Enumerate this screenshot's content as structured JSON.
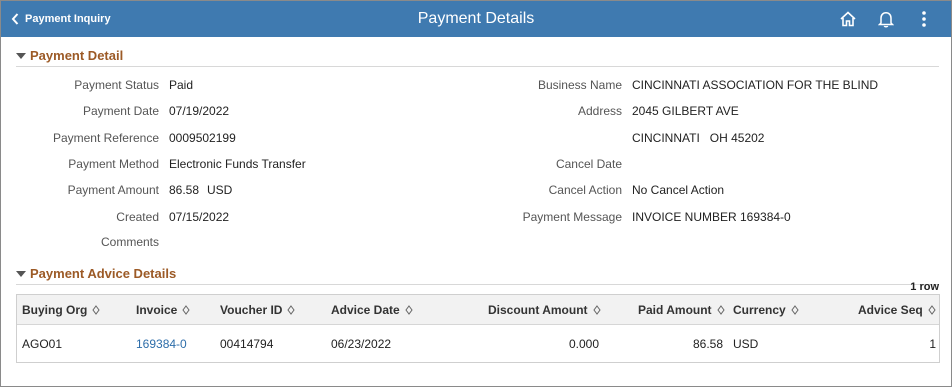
{
  "banner": {
    "back_label": "Payment Inquiry",
    "title": "Payment Details",
    "icons": [
      "home-icon",
      "bell-icon",
      "more-vertical-icon"
    ],
    "color": "#3f7ab0"
  },
  "payment_detail": {
    "section_title": "Payment Detail",
    "left_fields": [
      {
        "label": "Payment Status",
        "value": "Paid"
      },
      {
        "label": "Payment Date",
        "value": "07/19/2022"
      },
      {
        "label": "Payment Reference",
        "value": "0009502199"
      },
      {
        "label": "Payment Method",
        "value": "Electronic Funds Transfer"
      },
      {
        "label": "Payment Amount",
        "value": "86.58",
        "currency": "USD"
      },
      {
        "label": "Created",
        "value": "07/15/2022"
      },
      {
        "label": "Comments",
        "value": ""
      }
    ],
    "right_fields": [
      {
        "label": "Business Name",
        "value": "CINCINNATI ASSOCIATION FOR THE BLIND"
      },
      {
        "label": "Address",
        "value": "2045 GILBERT AVE"
      },
      {
        "label": "",
        "value": "CINCINNATI   OH 45202"
      },
      {
        "label": "Cancel Date",
        "value": ""
      },
      {
        "label": "Cancel Action",
        "value": "No Cancel Action"
      },
      {
        "label": "Payment Message",
        "value": "INVOICE NUMBER 169384-0"
      }
    ]
  },
  "advice": {
    "section_title": "Payment Advice Details",
    "row_count": "1 row",
    "columns": [
      "Buying Org",
      "Invoice",
      "Voucher ID",
      "Advice Date",
      "Discount Amount",
      "Paid Amount",
      "Currency",
      "Advice Seq"
    ],
    "rows": [
      {
        "buying_org": "AGO01",
        "invoice": "169384-0",
        "voucher_id": "00414794",
        "advice_date": "06/23/2022",
        "discount_amount": "0.000",
        "paid_amount": "86.58",
        "currency": "USD",
        "advice_seq": "1"
      }
    ]
  },
  "colors": {
    "section_title": "#9c5a26",
    "link": "#2d6da9"
  }
}
